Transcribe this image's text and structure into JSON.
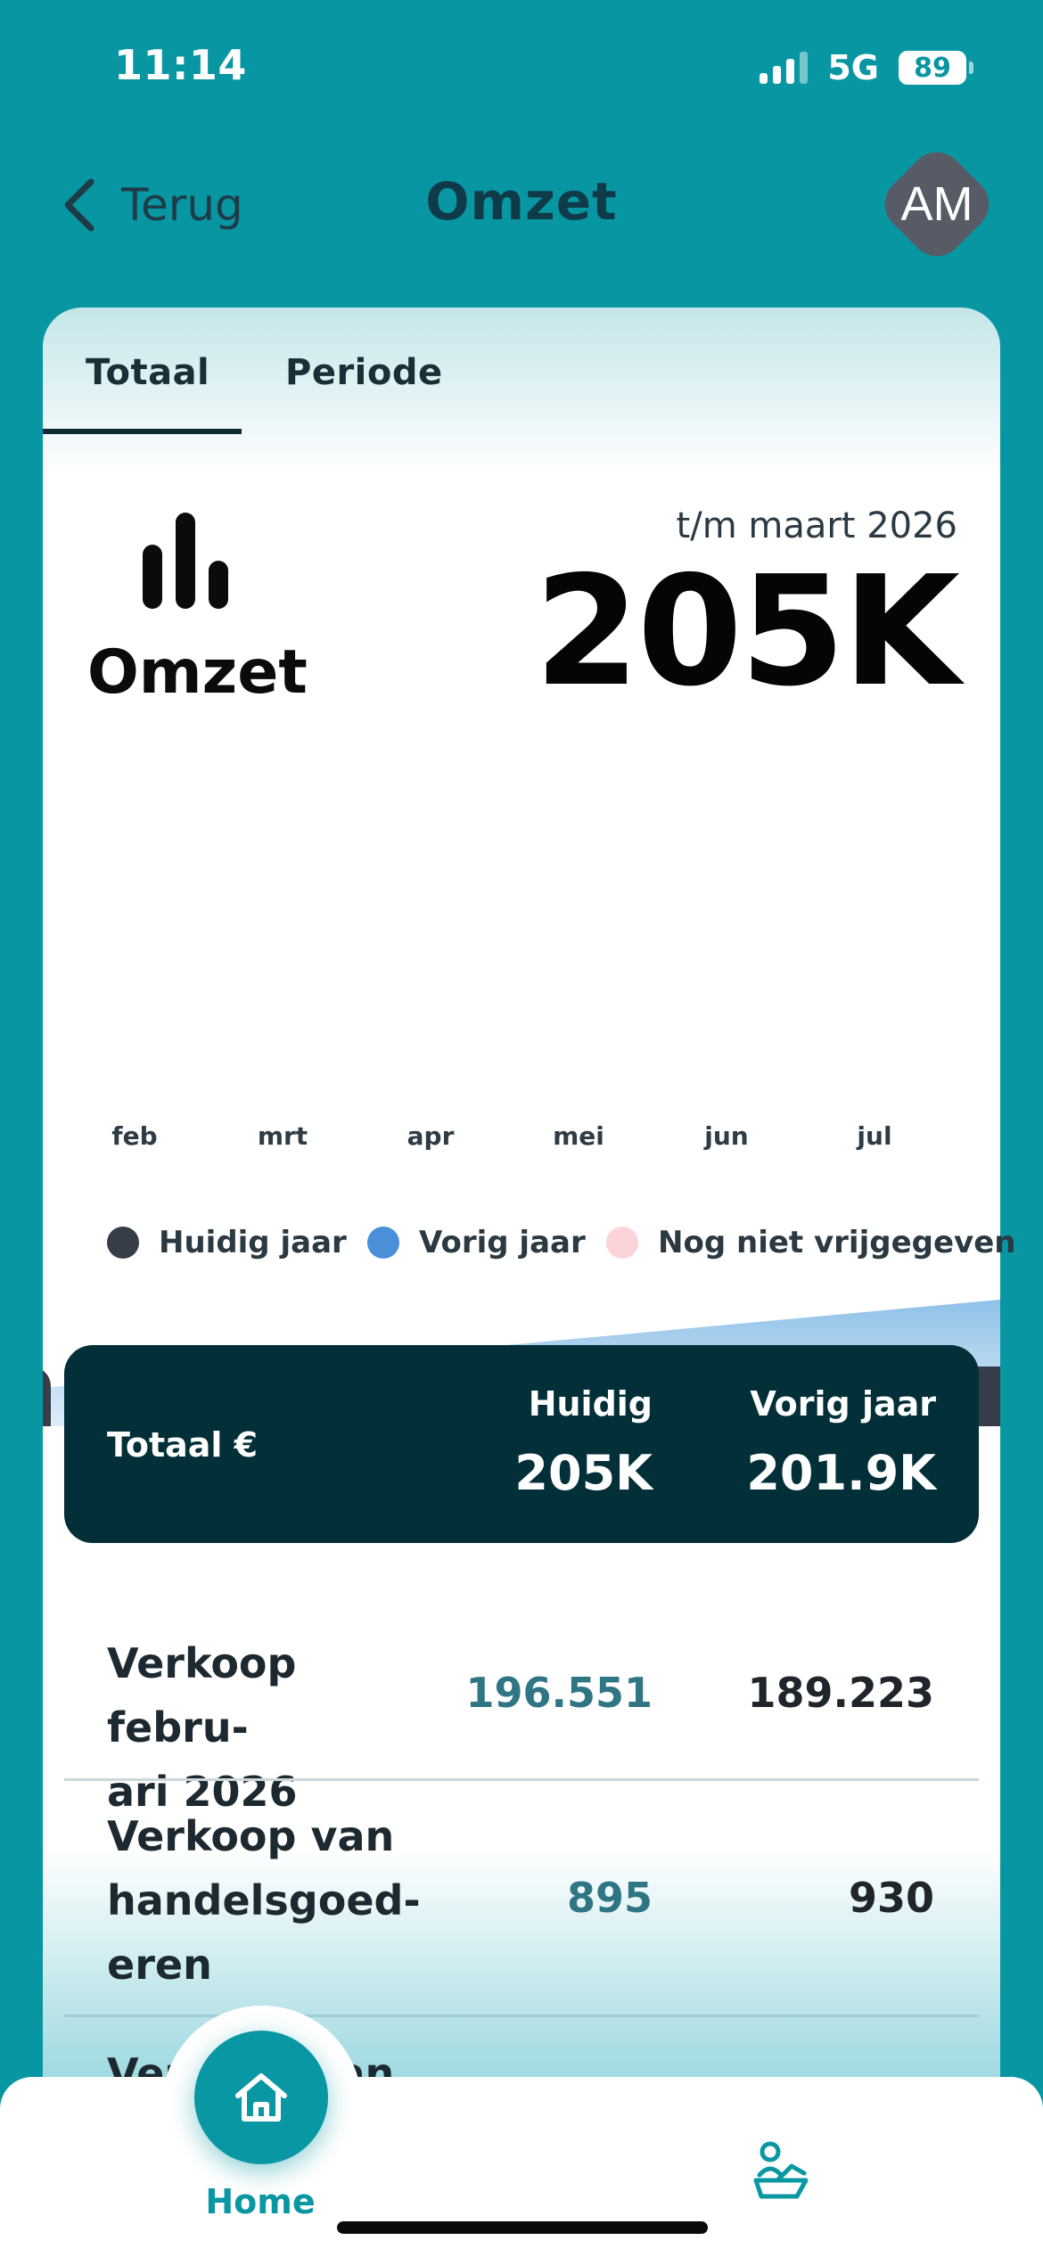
{
  "status": {
    "time": "11:14",
    "network": "5G",
    "battery": "89"
  },
  "header": {
    "back_label": "Terug",
    "title": "Omzet",
    "avatar_initials": "AM"
  },
  "tabs": [
    {
      "label": "Totaal",
      "active": true
    },
    {
      "label": "Periode",
      "active": false
    }
  ],
  "summary": {
    "metric_label": "Omzet",
    "period_label": "t/m maart 2026",
    "value": "205K"
  },
  "chart_data": {
    "type": "bar",
    "categories": [
      "feb",
      "mrt",
      "apr",
      "mei",
      "jun",
      "jul"
    ],
    "selected_category": "mrt",
    "legend": [
      {
        "label": "Huidig jaar",
        "color": "#363d48"
      },
      {
        "label": "Vorig jaar",
        "color": "#4a90d9"
      },
      {
        "label": "Nog niet vrijgegeven",
        "color": "#fbd3d8"
      }
    ],
    "highlight_color": "#3fb1c0"
  },
  "totals": {
    "label": "Totaal €",
    "current_header": "Huidig",
    "current_value": "205K",
    "previous_header": "Vorig jaar",
    "previous_value": "201.9K"
  },
  "rows": [
    {
      "label_lines": [
        "Verkoop febru-",
        "ari 2026"
      ],
      "current": "196.551",
      "previous": "189.223"
    },
    {
      "label_lines": [
        "Verkoop van",
        "handelsgoed-",
        "eren"
      ],
      "current": "895",
      "previous": "930"
    },
    {
      "label_partial": "Verkoop van"
    }
  ],
  "nav": {
    "home_label": "Home"
  },
  "colors": {
    "background": "#0896a3",
    "accent": "#0997a4",
    "dark_block": "#022f38"
  }
}
